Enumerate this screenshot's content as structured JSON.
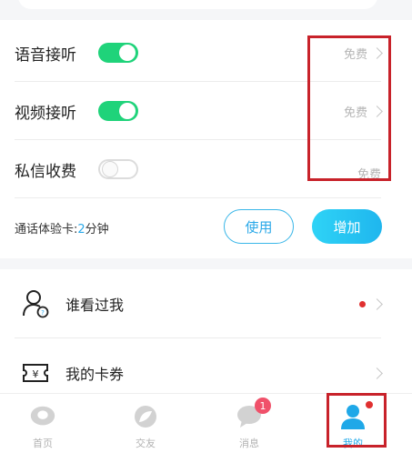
{
  "settings": {
    "voice": {
      "label": "语音接听",
      "price": "免费",
      "enabled": true
    },
    "video": {
      "label": "视频接听",
      "price": "免费",
      "enabled": true
    },
    "private_msg": {
      "label": "私信收费",
      "price": "免费",
      "enabled": false
    }
  },
  "call_card": {
    "prefix": "通话体验卡:",
    "minutes": "2",
    "suffix": "分钟",
    "use_button": "使用",
    "add_button": "增加"
  },
  "menu": {
    "items": [
      {
        "label": "谁看过我",
        "icon": "visitors-icon",
        "has_dot": true
      },
      {
        "label": "我的卡券",
        "icon": "coupon-icon",
        "has_dot": false
      }
    ]
  },
  "tabbar": {
    "tabs": [
      {
        "label": "首页",
        "icon": "home-icon",
        "active": false
      },
      {
        "label": "交友",
        "icon": "leaf-icon",
        "active": false
      },
      {
        "label": "消息",
        "icon": "chat-icon",
        "active": false,
        "badge": "1"
      },
      {
        "label": "我的",
        "icon": "profile-icon",
        "active": true
      }
    ]
  },
  "colors": {
    "toggle_on": "#1fd37a",
    "accent_blue": "#1fa8e8",
    "highlight_red": "#c8222a",
    "badge_pink": "#f0516a"
  }
}
